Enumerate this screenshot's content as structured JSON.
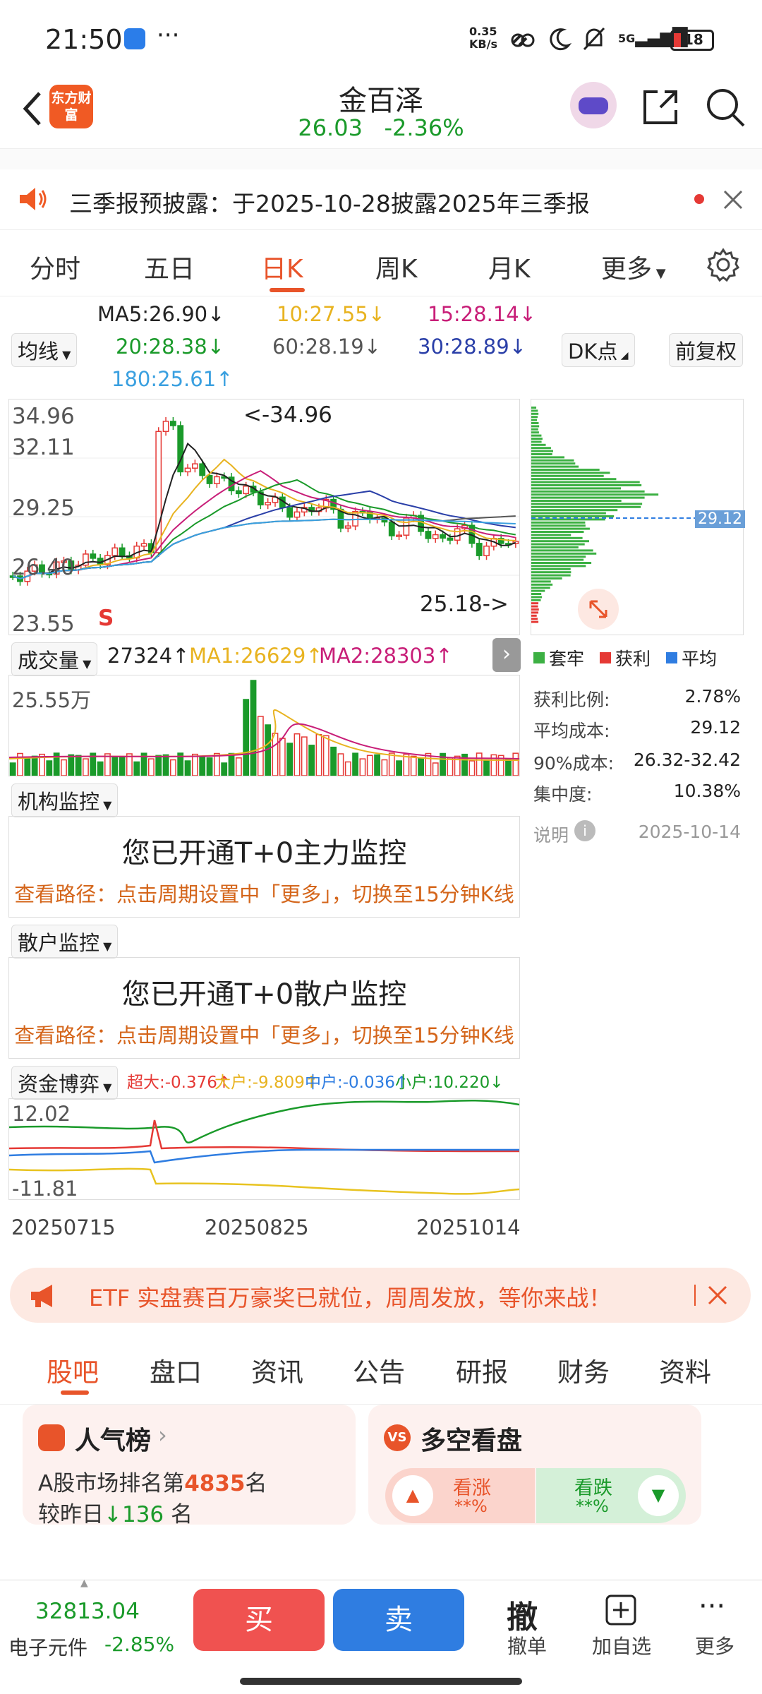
{
  "status_bar": {
    "time": "21:50",
    "net_speed": "0.35\nKB/s",
    "battery": "18"
  },
  "header": {
    "logo": "东方财富",
    "name": "金百泽",
    "price": "26.03",
    "change": "-2.36%"
  },
  "notice": {
    "text": "三季报预披露：于2025-10-28披露2025年三季报"
  },
  "period_tabs": [
    "分时",
    "五日",
    "日K",
    "周K",
    "月K",
    "更多"
  ],
  "indicator": {
    "type_label": "均线",
    "ma5": "MA5:26.90↓",
    "ma10": "10:27.55↓",
    "ma15": "15:28.14↓",
    "ma20": "20:28.38↓",
    "ma60": "60:28.19↓",
    "ma30": "30:28.89↓",
    "ma180": "180:25.61↑",
    "dk_label": "DK点",
    "adjust_label": "前复权"
  },
  "kline": {
    "y_labels": [
      "34.96",
      "32.11",
      "29.25",
      "26.40",
      "23.55"
    ],
    "high_annot": "<-34.96",
    "low_annot": "25.18->",
    "s_marker": "S"
  },
  "chip": {
    "avg_label": "29.12",
    "legend": [
      "套牢",
      "获利",
      "平均"
    ],
    "rows": [
      {
        "label": "获利比例:",
        "value": "2.78%"
      },
      {
        "label": "平均成本:",
        "value": "29.12"
      },
      {
        "label": "90%成本:",
        "value": "26.32-32.42"
      },
      {
        "label": "集中度:",
        "value": "10.38%"
      }
    ],
    "note_label": "说明",
    "note_date": "2025-10-14"
  },
  "volume": {
    "type_label": "成交量",
    "vol": "27324↑",
    "ma1": "MA1:26629↑",
    "ma2": "MA2:28303↑",
    "y_label": "25.55万"
  },
  "inst_monitor": {
    "type_label": "机构监控",
    "title": "您已开通T+0主力监控",
    "path": "查看路径：点击周期设置中「更多」，切换至15分钟K线"
  },
  "retail_monitor": {
    "type_label": "散户监控",
    "title": "您已开通T+0散户监控",
    "path": "查看路径：点击周期设置中「更多」，切换至15分钟K线"
  },
  "fund_game": {
    "type_label": "资金博弈",
    "super": "超大:-0.376↑",
    "large": "大户:-9.809↑",
    "mid": "中户:-0.036↑",
    "small": "小户:10.220↓",
    "y_top": "12.02",
    "y_bottom": "-11.81",
    "dates": [
      "20250715",
      "20250825",
      "20251014"
    ]
  },
  "etf_banner": {
    "text": "ETF 实盘赛百万豪奖已就位，周周发放，等你来战！"
  },
  "bottom_tabs": [
    "股吧",
    "盘口",
    "资讯",
    "公告",
    "研报",
    "财务",
    "资料"
  ],
  "popularity": {
    "title": "人气榜",
    "rank_prefix": "A股市场排名第",
    "rank": "4835",
    "rank_suffix": "名",
    "change_prefix": "较昨日",
    "change": "136",
    "change_suffix": "名"
  },
  "bullbear": {
    "title": "多空看盘",
    "up_label": "看涨",
    "up_val": "**%",
    "down_label": "看跌",
    "down_val": "**%"
  },
  "bottom_bar": {
    "index_value": "32813.04",
    "index_name": "电子元件",
    "index_change": "-2.85%",
    "buy": "买",
    "sell": "卖",
    "cancel_icon": "撤",
    "cancel_label": "撤单",
    "add_label": "加自选",
    "more_label": "更多"
  }
}
